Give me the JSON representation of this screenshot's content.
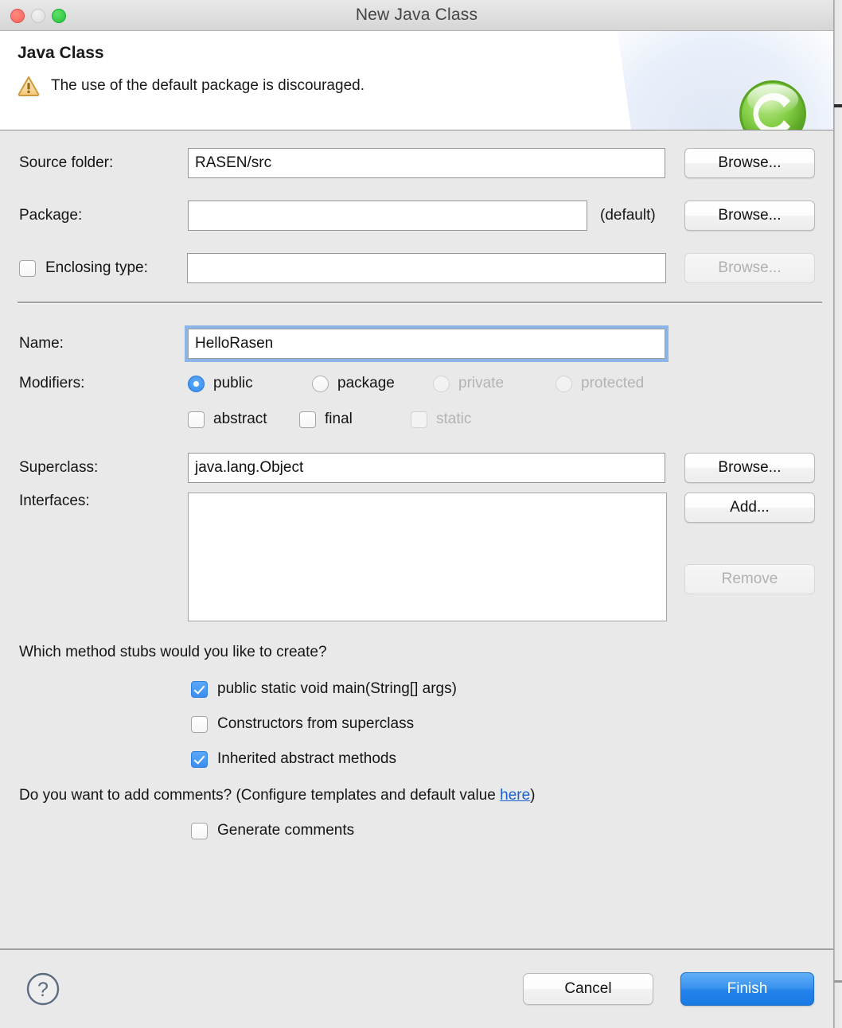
{
  "window": {
    "title": "New Java Class",
    "traffic_lights": [
      "close-button",
      "minimize-button",
      "maximize-button"
    ]
  },
  "header": {
    "title": "Java Class",
    "message": "The use of the default package is discouraged.",
    "warning_icon": "warning-triangle-icon",
    "class_icon": "java-class-green-c-icon",
    "warning_color": "#e8a33d"
  },
  "form": {
    "source_folder": {
      "label": "Source folder:",
      "value": "RASEN/src",
      "browse_label": "Browse..."
    },
    "package": {
      "label": "Package:",
      "value": "",
      "default_tag": "(default)",
      "browse_label": "Browse..."
    },
    "enclosing_type": {
      "label": "Enclosing type:",
      "checked": false,
      "value": "",
      "browse_label": "Browse...",
      "browse_disabled": true
    },
    "name": {
      "label": "Name:",
      "value": "HelloRasen",
      "focused": true
    },
    "modifiers": {
      "label": "Modifiers:",
      "access": [
        {
          "label": "public",
          "selected": true,
          "disabled": false
        },
        {
          "label": "package",
          "selected": false,
          "disabled": false
        },
        {
          "label": "private",
          "selected": false,
          "disabled": true
        },
        {
          "label": "protected",
          "selected": false,
          "disabled": true
        }
      ],
      "flags": [
        {
          "label": "abstract",
          "checked": false,
          "disabled": false
        },
        {
          "label": "final",
          "checked": false,
          "disabled": false
        },
        {
          "label": "static",
          "checked": false,
          "disabled": true
        }
      ]
    },
    "superclass": {
      "label": "Superclass:",
      "value": "java.lang.Object",
      "browse_label": "Browse..."
    },
    "interfaces": {
      "label": "Interfaces:",
      "items": [],
      "add_label": "Add...",
      "remove_label": "Remove",
      "remove_disabled": true
    }
  },
  "stubs": {
    "question": "Which method stubs would you like to create?",
    "options": [
      {
        "label": "public static void main(String[] args)",
        "checked": true
      },
      {
        "label": "Constructors from superclass",
        "checked": false
      },
      {
        "label": "Inherited abstract methods",
        "checked": true
      }
    ],
    "comments_question_before": "Do you want to add comments? (Configure templates and default value ",
    "comments_link": "here",
    "comments_question_after": ")",
    "generate_comments": {
      "label": "Generate comments",
      "checked": false
    }
  },
  "footer": {
    "help_icon": "help-question-icon",
    "cancel_label": "Cancel",
    "finish_label": "Finish",
    "finish_color": "#2383ea"
  }
}
